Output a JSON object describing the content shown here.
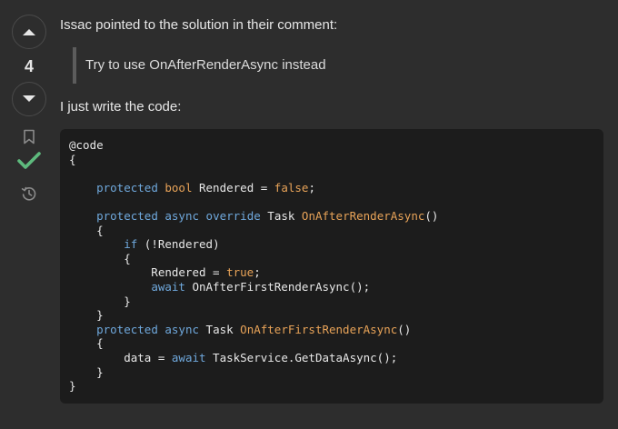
{
  "votes": {
    "count": "4"
  },
  "post": {
    "intro": "Issac pointed to the solution in their comment:",
    "quote": "Try to use OnAfterRenderAsync instead",
    "followup": "I just write the code:"
  },
  "code": {
    "lines": [
      [
        {
          "t": "@code",
          "c": ""
        }
      ],
      [
        {
          "t": "{",
          "c": ""
        }
      ],
      [],
      [
        {
          "t": "    ",
          "c": ""
        },
        {
          "t": "protected",
          "c": "kw"
        },
        {
          "t": " ",
          "c": ""
        },
        {
          "t": "bool",
          "c": "lit"
        },
        {
          "t": " Rendered = ",
          "c": ""
        },
        {
          "t": "false",
          "c": "lit"
        },
        {
          "t": ";",
          "c": ""
        }
      ],
      [],
      [
        {
          "t": "    ",
          "c": ""
        },
        {
          "t": "protected",
          "c": "kw"
        },
        {
          "t": " ",
          "c": ""
        },
        {
          "t": "async",
          "c": "kw"
        },
        {
          "t": " ",
          "c": ""
        },
        {
          "t": "override",
          "c": "kw"
        },
        {
          "t": " Task ",
          "c": ""
        },
        {
          "t": "OnAfterRenderAsync",
          "c": "fn"
        },
        {
          "t": "()",
          "c": ""
        }
      ],
      [
        {
          "t": "    {",
          "c": ""
        }
      ],
      [
        {
          "t": "        ",
          "c": ""
        },
        {
          "t": "if",
          "c": "kw"
        },
        {
          "t": " (!Rendered)",
          "c": ""
        }
      ],
      [
        {
          "t": "        {",
          "c": ""
        }
      ],
      [
        {
          "t": "            Rendered = ",
          "c": ""
        },
        {
          "t": "true",
          "c": "lit"
        },
        {
          "t": ";",
          "c": ""
        }
      ],
      [
        {
          "t": "            ",
          "c": ""
        },
        {
          "t": "await",
          "c": "kw"
        },
        {
          "t": " OnAfterFirstRenderAsync();",
          "c": ""
        }
      ],
      [
        {
          "t": "        }",
          "c": ""
        }
      ],
      [
        {
          "t": "    }",
          "c": ""
        }
      ],
      [
        {
          "t": "    ",
          "c": ""
        },
        {
          "t": "protected",
          "c": "kw"
        },
        {
          "t": " ",
          "c": ""
        },
        {
          "t": "async",
          "c": "kw"
        },
        {
          "t": " Task ",
          "c": ""
        },
        {
          "t": "OnAfterFirstRenderAsync",
          "c": "fn"
        },
        {
          "t": "()",
          "c": ""
        }
      ],
      [
        {
          "t": "    {",
          "c": ""
        }
      ],
      [
        {
          "t": "        data = ",
          "c": ""
        },
        {
          "t": "await",
          "c": "kw"
        },
        {
          "t": " TaskService.GetDataAsync();",
          "c": ""
        }
      ],
      [
        {
          "t": "    }",
          "c": ""
        }
      ],
      [
        {
          "t": "}",
          "c": ""
        }
      ]
    ]
  },
  "icons": {
    "upvote": "upvote-arrow-icon",
    "downvote": "downvote-arrow-icon",
    "bookmark": "bookmark-icon",
    "accepted": "accepted-checkmark-icon",
    "history": "history-icon"
  },
  "colors": {
    "background": "#2d2d2d",
    "code_background": "#1c1c1c",
    "keyword": "#6fa8dc",
    "literal": "#e8a358",
    "accepted": "#5eba7d"
  }
}
